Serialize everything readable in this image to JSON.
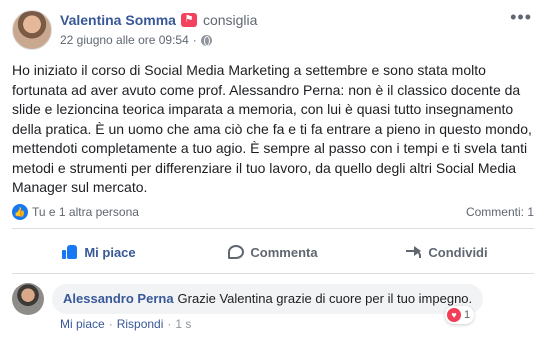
{
  "post": {
    "author": "Valentina Somma",
    "recommend_label": "consiglia",
    "date": "22 giugno alle ore 09:54",
    "meta_separator": "·",
    "body": "Ho iniziato il corso di Social Media Marketing a settembre e sono stata molto fortunata ad aver avuto come prof. Alessandro Perna: non è il classico docente da slide e lezioncina teorica imparata a memoria, con lui è quasi tutto insegnamento della pratica. È un uomo che ama ciò che fa e ti fa entrare a pieno in questo mondo, mettendoti completamente a tuo agio. È sempre al passo con i tempi e ti svela tanti metodi e strumenti per differenziare il tuo lavoro, da quello degli altri Social Media Manager sul mercato."
  },
  "reactions": {
    "reactors_text": "Tu e 1 altra persona",
    "comments_count": "Commenti: 1"
  },
  "actions": {
    "like": "Mi piace",
    "comment": "Commenta",
    "share": "Condividi"
  },
  "comment": {
    "author": "Alessandro Perna",
    "text": "Grazie Valentina grazie di cuore per il tuo impegno.",
    "reaction_count": "1",
    "like_link": "Mi piace",
    "reply_link": "Rispondi",
    "separator": "·",
    "time": "1 s"
  },
  "icons": {
    "options": "more-options-icon",
    "recommend": "recommend-badge-icon",
    "privacy": "globe-icon",
    "like_reaction": "like-reaction-icon",
    "like_action": "thumb-up-icon",
    "comment_action": "comment-bubble-icon",
    "share_action": "share-arrow-icon",
    "heart_reaction": "heart-icon"
  },
  "colors": {
    "link_blue": "#385898",
    "like_blue": "#1877f2",
    "secondary_text": "#606770",
    "recommend_red": "#f3425f",
    "heart_red": "#f33e58"
  }
}
